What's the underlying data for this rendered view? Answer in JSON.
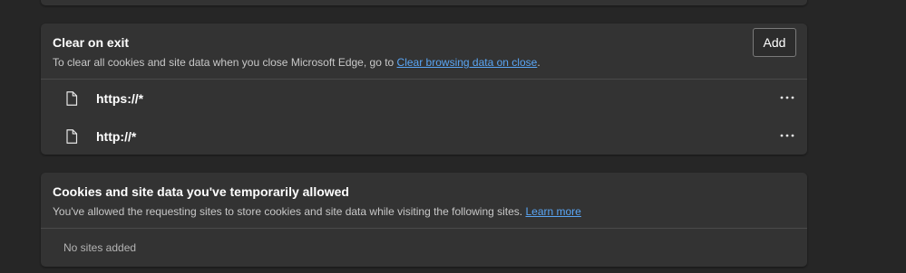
{
  "clear_on_exit": {
    "title": "Clear on exit",
    "description_prefix": "To clear all cookies and site data when you close Microsoft Edge, go to ",
    "description_link": "Clear browsing data on close",
    "description_suffix": ".",
    "add_label": "Add",
    "sites": [
      {
        "label": "https://*",
        "icon": "file-icon",
        "menu_icon": "more-options-icon"
      },
      {
        "label": "http://*",
        "icon": "file-icon",
        "menu_icon": "more-options-icon"
      }
    ]
  },
  "temporarily_allowed": {
    "title": "Cookies and site data you've temporarily allowed",
    "description": "You've allowed the requesting sites to store cookies and site data while visiting the following sites. ",
    "learn_more": "Learn more",
    "empty_text": "No sites added"
  },
  "colors": {
    "background": "#262626",
    "card": "#333333",
    "link": "#5aa6f5",
    "divider": "#4a4a4a"
  }
}
